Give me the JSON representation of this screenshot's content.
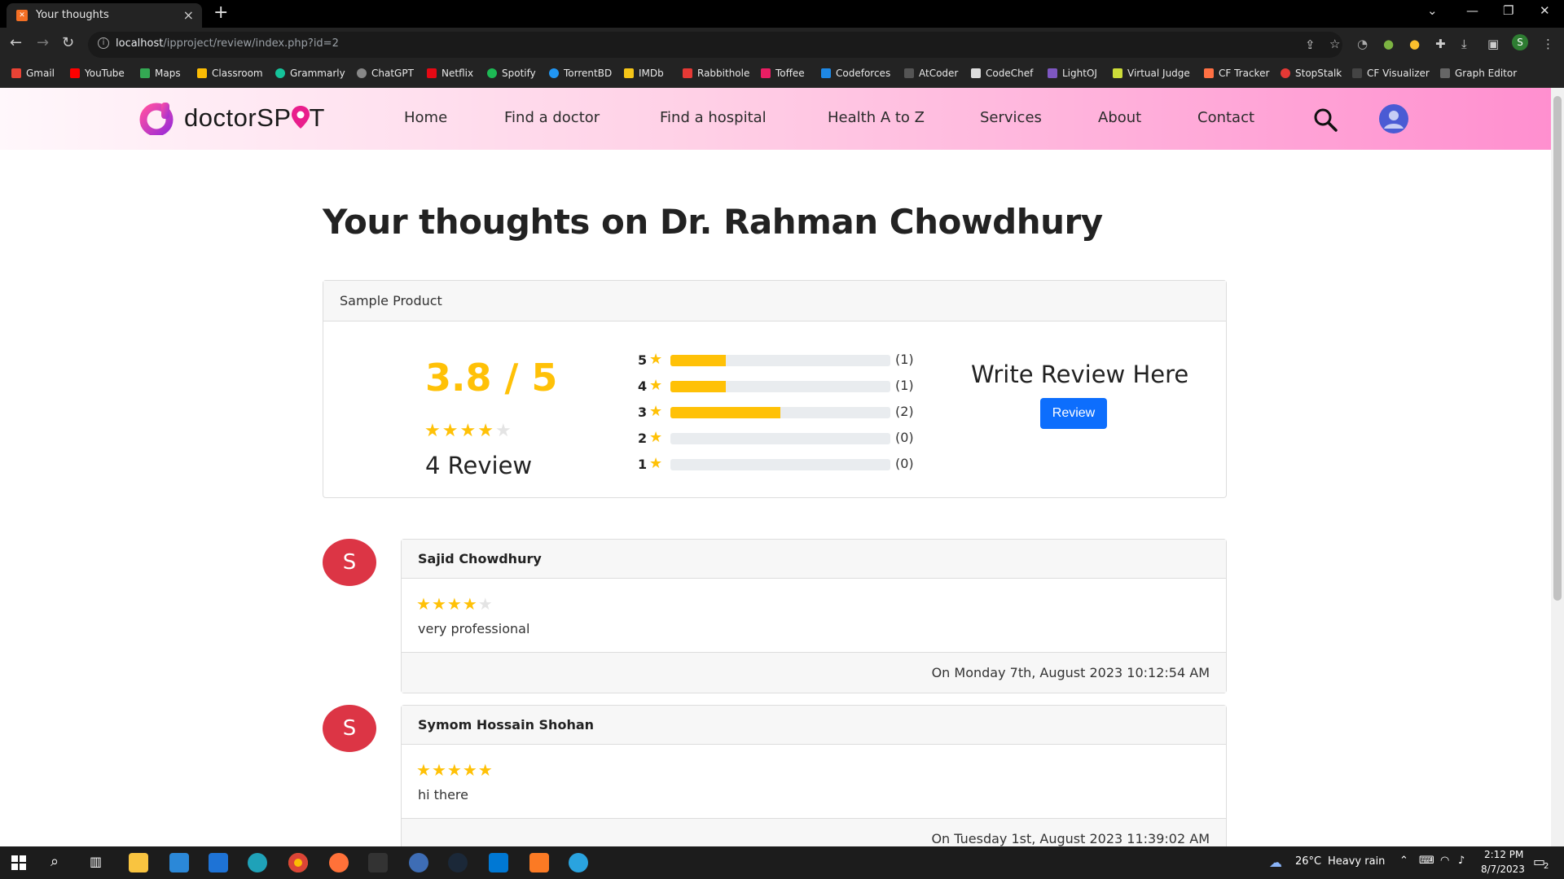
{
  "browser": {
    "tab_title": "Your thoughts",
    "url_host": "localhost",
    "url_path": "/ipproject/review/index.php?id=2",
    "bookmarks": [
      "Gmail",
      "YouTube",
      "Maps",
      "Classroom",
      "Grammarly",
      "ChatGPT",
      "Netflix",
      "Spotify",
      "TorrentBD",
      "IMDb",
      "Rabbithole",
      "Toffee",
      "Codeforces",
      "AtCoder",
      "CodeChef",
      "LightOJ",
      "Virtual Judge",
      "CF Tracker",
      "StopStalk",
      "CF Visualizer",
      "Graph Editor"
    ],
    "profile_initial": "S"
  },
  "site": {
    "logo_text": "doctorSP",
    "logo_text_end": "T",
    "nav": [
      "Home",
      "Find a doctor",
      "Find a hospital",
      "Health A to Z",
      "Services",
      "About",
      "Contact"
    ]
  },
  "page": {
    "heading": "Your thoughts on Dr. Rahman Chowdhury",
    "summary": {
      "header": "Sample Product",
      "average": "3.8 / 5",
      "average_stars": 4,
      "review_count": "4 Review",
      "breakdown": [
        {
          "star": "5",
          "count": "(1)",
          "fraction": 0.25
        },
        {
          "star": "4",
          "count": "(1)",
          "fraction": 0.25
        },
        {
          "star": "3",
          "count": "(2)",
          "fraction": 0.5
        },
        {
          "star": "2",
          "count": "(0)",
          "fraction": 0
        },
        {
          "star": "1",
          "count": "(0)",
          "fraction": 0
        }
      ],
      "write_title": "Write Review Here",
      "review_button": "Review"
    },
    "reviews": [
      {
        "initial": "S",
        "name": "Sajid Chowdhury",
        "stars": 4,
        "text": "very professional",
        "date": "On Monday 7th, August 2023 10:12:54 AM"
      },
      {
        "initial": "S",
        "name": "Symom Hossain Shohan",
        "stars": 5,
        "text": "hi there",
        "date": "On Tuesday 1st, August 2023 11:39:02 AM"
      }
    ]
  },
  "taskbar": {
    "weather_temp": "26°C",
    "weather_desc": "Heavy rain",
    "time": "2:12 PM",
    "date": "8/7/2023",
    "notifications": "2"
  },
  "colors": {
    "accent_yellow": "#ffc107",
    "primary_blue": "#0d6efd",
    "avatar_red": "#dc3545"
  }
}
